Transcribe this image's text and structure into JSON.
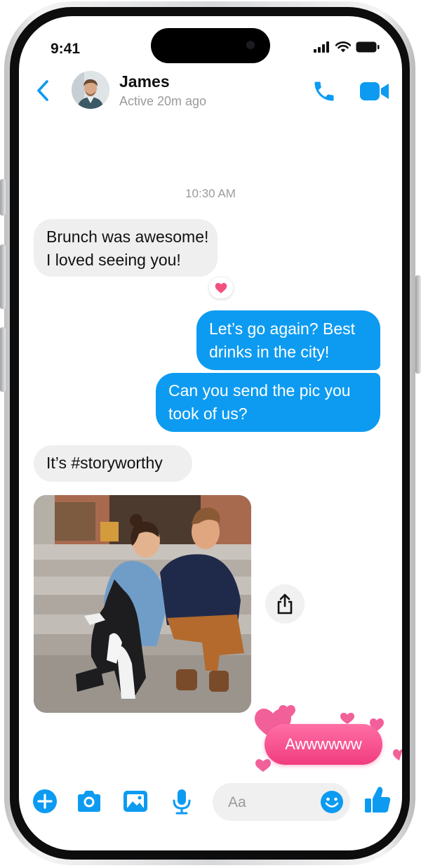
{
  "status_bar": {
    "time": "9:41"
  },
  "header": {
    "contact_name": "James",
    "activity": "Active 20m ago",
    "icons": [
      "back-icon",
      "phone-icon",
      "video-icon"
    ]
  },
  "conversation": {
    "timestamp": "10:30 AM",
    "messages": [
      {
        "from": "them",
        "lines": [
          "Brunch was awesome!",
          "I loved seeing you!"
        ],
        "reaction": "heart"
      },
      {
        "from": "me",
        "lines": [
          "Let’s go again? Best",
          "drinks in the city!"
        ]
      },
      {
        "from": "me",
        "lines": [
          "Can you send the pic you",
          "took of us?"
        ]
      },
      {
        "from": "them",
        "lines": [
          "It’s #storyworthy"
        ]
      },
      {
        "from": "them",
        "type": "photo"
      },
      {
        "from": "me",
        "lines": [
          "Awwwwww"
        ],
        "effect": "hearts"
      }
    ]
  },
  "composer": {
    "placeholder": "Aa",
    "icons": [
      "plus-icon",
      "camera-icon",
      "gallery-icon",
      "microphone-icon",
      "emoji-icon",
      "thumbs-up-icon"
    ]
  },
  "colors": {
    "accent": "#0d9bf1",
    "incoming_bubble": "#efefef",
    "reaction_heart": "#f2507f",
    "aww_bubble": "#f03c7e"
  }
}
